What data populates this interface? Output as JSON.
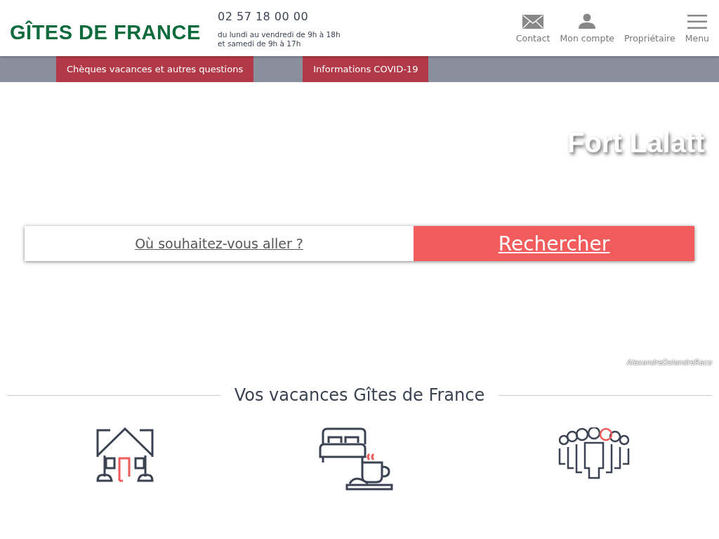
{
  "header": {
    "logo": "GÎTES DE FRANCE",
    "phone": "02 57 18 00 00",
    "hours": [
      "du lundi au vendredi de 9h à 18h",
      "et samedi de 9h à 17h"
    ],
    "nav": [
      {
        "kind": "mail",
        "label": "Contact"
      },
      {
        "kind": "person",
        "label": "Mon compte"
      },
      {
        "kind": "none",
        "label": "Propriétaire"
      },
      {
        "kind": "menu",
        "label": "Menu"
      }
    ]
  },
  "banner": {
    "links": [
      "Chèques vacances et autres questions",
      "Informations COVID-19"
    ]
  },
  "hero": {
    "title": "Fort Lalatt",
    "search": {
      "placeholder": "Où souhaitez-vous aller ?",
      "button": "Rechercher"
    },
    "credit": "AlexandreDelandreRaco"
  },
  "section": {
    "title": "Vos vacances Gîtes de France",
    "features": [
      {
        "kind": "house"
      },
      {
        "kind": "bed"
      },
      {
        "kind": "group"
      }
    ]
  }
}
